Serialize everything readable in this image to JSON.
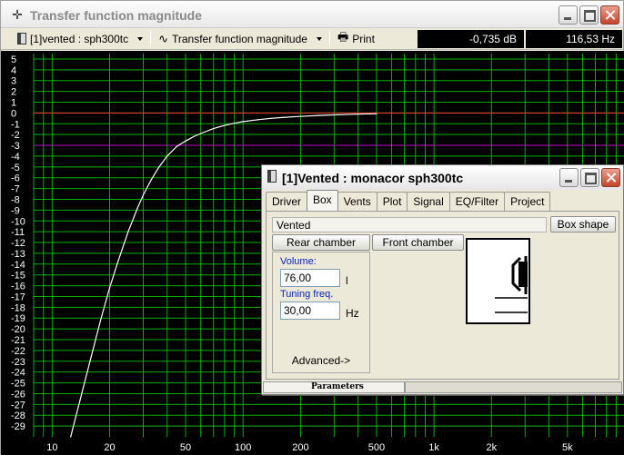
{
  "main_window": {
    "title": "Transfer function magnitude",
    "app_icon": "crosshair-icon"
  },
  "toolbar": {
    "document_selector": "[1]vented : sph300tc",
    "view_selector": "Transfer function magnitude",
    "print_label": "Print",
    "readout_db": "-0,735 dB",
    "readout_hz": "116,53 Hz"
  },
  "chart_data": {
    "type": "line",
    "title": "",
    "xlabel": "",
    "ylabel": "",
    "x_scale": "log",
    "xlim": [
      8,
      10000
    ],
    "ylim": [
      -30,
      5.5
    ],
    "x_ticks": [
      "10",
      "20",
      "50",
      "100",
      "200",
      "500",
      "1k",
      "2k",
      "5k"
    ],
    "x_tick_values": [
      10,
      20,
      50,
      100,
      200,
      500,
      1000,
      2000,
      5000
    ],
    "y_ticks": [
      5,
      4,
      3,
      2,
      1,
      0,
      -1,
      -2,
      -3,
      -4,
      -5,
      -6,
      -7,
      -8,
      -9,
      -10,
      -11,
      -12,
      -13,
      -14,
      -15,
      -16,
      -17,
      -18,
      -19,
      -20,
      -21,
      -22,
      -23,
      -24,
      -25,
      -26,
      -27,
      -28,
      -29
    ],
    "grid": true,
    "reference_lines": [
      {
        "y": 0,
        "color": "#ff3030"
      },
      {
        "y": -3,
        "color": "#c000c0"
      }
    ],
    "series": [
      {
        "color": "#ffffff",
        "x": [
          12.5,
          14,
          16,
          18,
          20,
          22,
          25,
          28,
          30,
          33,
          36,
          40,
          45,
          50,
          55,
          60,
          70,
          80,
          90,
          100,
          120,
          140,
          160,
          180,
          200,
          250,
          300,
          400,
          500
        ],
        "y": [
          -30,
          -26.6,
          -22.6,
          -19.1,
          -16.2,
          -13.9,
          -11,
          -8.8,
          -7.6,
          -6.2,
          -5.1,
          -4,
          -3.1,
          -2.6,
          -2.2,
          -1.9,
          -1.45,
          -1.15,
          -0.95,
          -0.8,
          -0.62,
          -0.5,
          -0.42,
          -0.36,
          -0.32,
          -0.23,
          -0.18,
          -0.11,
          -0.07
        ]
      }
    ],
    "colors": {
      "background": "#000000",
      "grid": "#00b000",
      "axis_text": "#ffffff"
    }
  },
  "dialog": {
    "title": "[1]Vented : monacor sph300tc",
    "tabs": [
      "Driver",
      "Box",
      "Vents",
      "Plot",
      "Signal",
      "EQ/Filter",
      "Project"
    ],
    "active_tab": "Box",
    "box_type": "Vented",
    "box_shape_button": "Box shape",
    "rear_chamber_button": "Rear chamber",
    "front_chamber_button": "Front chamber",
    "volume_label": "Volume:",
    "volume_value": "76,00",
    "volume_unit": "l",
    "tuning_label": "Tuning freq.",
    "tuning_value": "30,00",
    "tuning_unit": "Hz",
    "advanced_label": "Advanced->",
    "status_tab": "Parameters"
  }
}
